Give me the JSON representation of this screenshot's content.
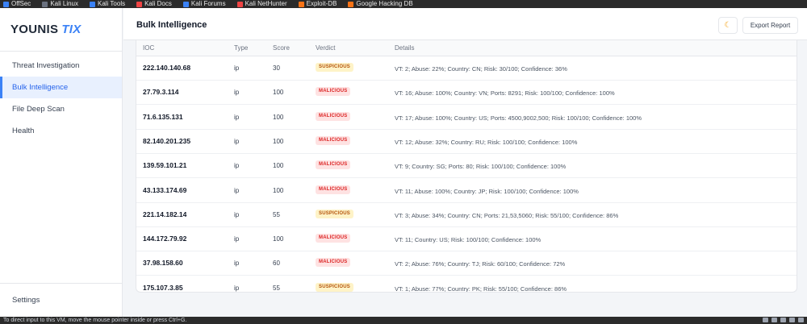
{
  "bookmarks": [
    {
      "label": "OffSec",
      "icon": "offsec-icon",
      "color": "#3b82f6"
    },
    {
      "label": "Kali Linux",
      "icon": "kali-dragon-icon",
      "color": "#6b7280"
    },
    {
      "label": "Kali Tools",
      "icon": "kali-tools-icon",
      "color": "#3b82f6"
    },
    {
      "label": "Kali Docs",
      "icon": "kali-docs-icon",
      "color": "#ef4444"
    },
    {
      "label": "Kali Forums",
      "icon": "kali-forums-icon",
      "color": "#3b82f6"
    },
    {
      "label": "Kali NetHunter",
      "icon": "nethunter-icon",
      "color": "#ef4444"
    },
    {
      "label": "Exploit-DB",
      "icon": "exploit-db-icon",
      "color": "#f97316"
    },
    {
      "label": "Google Hacking DB",
      "icon": "ghdb-icon",
      "color": "#f97316"
    }
  ],
  "sidebar": {
    "logo_main": "YOUNIS",
    "logo_accent": "TIX",
    "items": [
      {
        "label": "Threat Investigation",
        "active": false
      },
      {
        "label": "Bulk Intelligence",
        "active": true
      },
      {
        "label": "File Deep Scan",
        "active": false
      },
      {
        "label": "Health",
        "active": false
      }
    ],
    "settings_label": "Settings"
  },
  "header": {
    "title": "Bulk Intelligence",
    "theme_icon": "moon-icon",
    "export_label": "Export Report"
  },
  "table": {
    "columns": [
      "IOC",
      "Type",
      "Score",
      "Verdict",
      "Details"
    ],
    "rows": [
      {
        "ioc": "222.140.140.68",
        "type": "ip",
        "score": "30",
        "verdict": "SUSPICIOUS",
        "details": "VT: 2; Abuse: 22%; Country: CN; Risk: 30/100; Confidence: 36%"
      },
      {
        "ioc": "27.79.3.114",
        "type": "ip",
        "score": "100",
        "verdict": "MALICIOUS",
        "details": "VT: 16; Abuse: 100%; Country: VN; Ports: 8291; Risk: 100/100; Confidence: 100%"
      },
      {
        "ioc": "71.6.135.131",
        "type": "ip",
        "score": "100",
        "verdict": "MALICIOUS",
        "details": "VT: 17; Abuse: 100%; Country: US; Ports: 4500,9002,500; Risk: 100/100; Confidence: 100%"
      },
      {
        "ioc": "82.140.201.235",
        "type": "ip",
        "score": "100",
        "verdict": "MALICIOUS",
        "details": "VT: 12; Abuse: 32%; Country: RU; Risk: 100/100; Confidence: 100%"
      },
      {
        "ioc": "139.59.101.21",
        "type": "ip",
        "score": "100",
        "verdict": "MALICIOUS",
        "details": "VT: 9; Country: SG; Ports: 80; Risk: 100/100; Confidence: 100%"
      },
      {
        "ioc": "43.133.174.69",
        "type": "ip",
        "score": "100",
        "verdict": "MALICIOUS",
        "details": "VT: 11; Abuse: 100%; Country: JP; Risk: 100/100; Confidence: 100%"
      },
      {
        "ioc": "221.14.182.14",
        "type": "ip",
        "score": "55",
        "verdict": "SUSPICIOUS",
        "details": "VT: 3; Abuse: 34%; Country: CN; Ports: 21,53,5060; Risk: 55/100; Confidence: 86%"
      },
      {
        "ioc": "144.172.79.92",
        "type": "ip",
        "score": "100",
        "verdict": "MALICIOUS",
        "details": "VT: 11; Country: US; Risk: 100/100; Confidence: 100%"
      },
      {
        "ioc": "37.98.158.60",
        "type": "ip",
        "score": "60",
        "verdict": "MALICIOUS",
        "details": "VT: 2; Abuse: 76%; Country: TJ; Risk: 60/100; Confidence: 72%"
      },
      {
        "ioc": "175.107.3.85",
        "type": "ip",
        "score": "55",
        "verdict": "SUSPICIOUS",
        "details": "VT: 1; Abuse: 77%; Country: PK; Risk: 55/100; Confidence: 86%"
      }
    ]
  },
  "statusbar": {
    "text": "To direct input to this VM, move the mouse pointer inside or press Ctrl+G."
  }
}
